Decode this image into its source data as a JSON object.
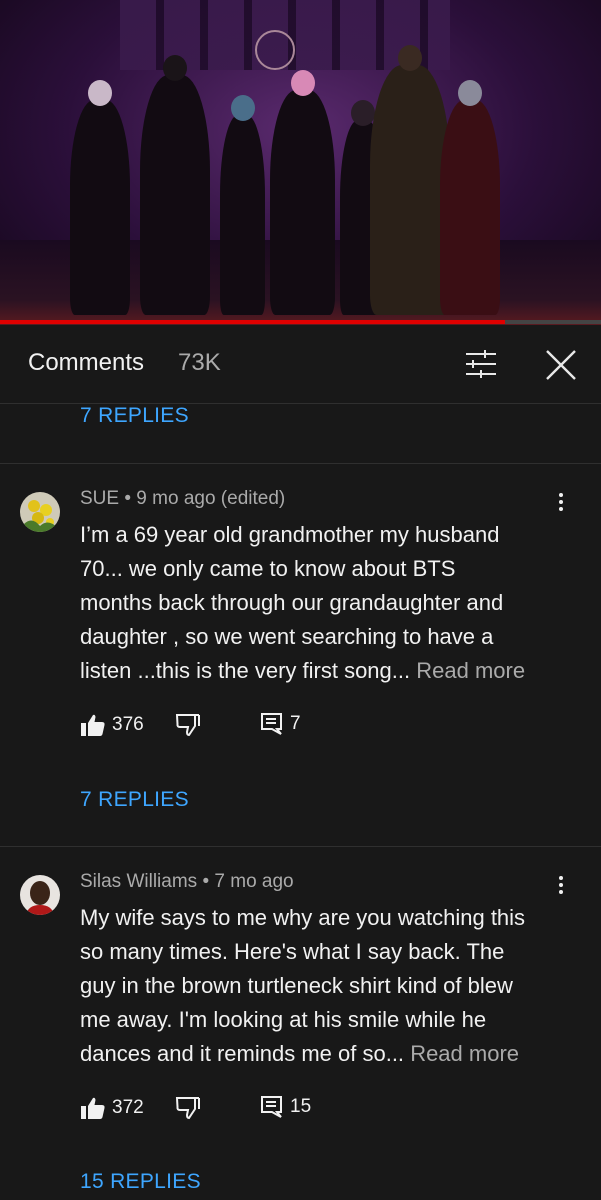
{
  "video": {
    "progress": 0.84
  },
  "header": {
    "title": "Comments",
    "count": "73K"
  },
  "top_replies": "7 REPLIES",
  "comments": [
    {
      "author": "SUE",
      "time": "9 mo ago (edited)",
      "lines": [
        "I’m a 69 year old grandmother my husband",
        "70... we only came to know about BTS",
        "months back through our grandaughter and",
        "daughter , so we went searching to have a",
        "listen ...this is the very first song..."
      ],
      "read_more": "Read more",
      "likes": "376",
      "reply_count": "7",
      "replies_label": "7 REPLIES"
    },
    {
      "author": "Silas Williams",
      "time": "7 mo ago",
      "lines": [
        "My wife says to me why are you watching this",
        "so many times.  Here's what I say back.  The",
        "guy in the brown turtleneck shirt kind of blew",
        "me away.  I'm looking at his smile while he",
        "dances and it reminds me of so..."
      ],
      "read_more": "Read more",
      "likes": "372",
      "reply_count": "15",
      "replies_label": "15 REPLIES"
    }
  ],
  "colors": {
    "accent": "#3ea6ff",
    "background": "#181818",
    "progress": "#e00000"
  },
  "icons": [
    "filter-icon",
    "close-icon",
    "like-icon",
    "dislike-icon",
    "reply-icon",
    "more-vert-icon"
  ]
}
